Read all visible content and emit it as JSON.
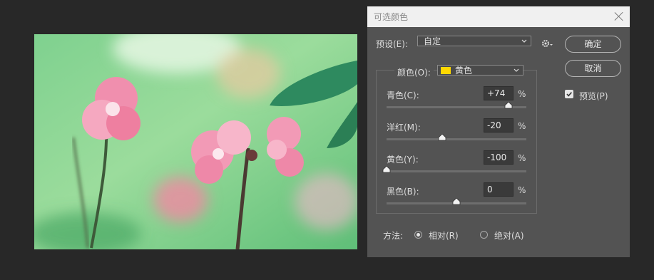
{
  "dialog": {
    "title": "可选颜色",
    "preset_label": "预设(E):",
    "preset_value": "自定",
    "ok_label": "确定",
    "cancel_label": "取消",
    "preview_label": "预览(P)",
    "preview_checked": true,
    "colors_label": "颜色(O):",
    "colors_value": "黄色",
    "colors_swatch": "#ffd800",
    "sliders": [
      {
        "label": "青色(C):",
        "value": "+74",
        "unit": "%",
        "percent": 74
      },
      {
        "label": "洋红(M):",
        "value": "-20",
        "unit": "%",
        "percent": -20
      },
      {
        "label": "黄色(Y):",
        "value": "-100",
        "unit": "%",
        "percent": -100
      },
      {
        "label": "黑色(B):",
        "value": "0",
        "unit": "%",
        "percent": 0
      }
    ],
    "method_label": "方法:",
    "method_relative": "相对(R)",
    "method_absolute": "绝对(A)",
    "method_selected": "relative"
  },
  "icons": {
    "close": "close-icon",
    "gear": "gear-icon",
    "dropdown": "chevron-down-icon",
    "check": "check-icon"
  }
}
